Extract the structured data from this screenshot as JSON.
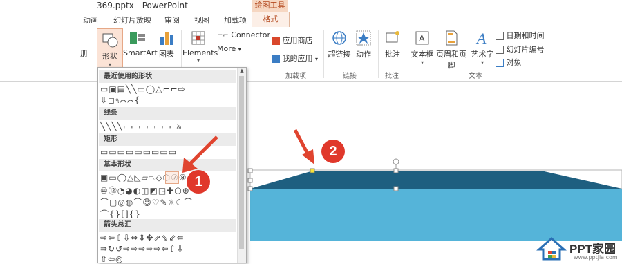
{
  "window": {
    "title": "369.pptx - PowerPoint",
    "contextual_group": "绘图工具"
  },
  "tabs": [
    "动画",
    "幻灯片放映",
    "审阅",
    "视图",
    "加载项",
    "格式"
  ],
  "ribbon": {
    "partial_left_label": "册",
    "shapes_label": "形状",
    "smartart_label": "SmartArt",
    "chart_label": "图表",
    "elements_label": "Elements",
    "connector_label": "Connector",
    "more_label": "More",
    "app_store_label": "应用商店",
    "my_apps_label": "我的应用",
    "addins_group": "加载项",
    "hyperlink_label": "超链接",
    "action_label": "动作",
    "links_group": "链接",
    "comment_label": "批注",
    "comments_group": "批注",
    "textbox_label": "文本框",
    "header_footer_label": "页眉和页脚",
    "wordart_label": "艺术字",
    "datetime_label": "日期和时间",
    "slide_number_label": "幻灯片编号",
    "object_label": "对象",
    "text_group": "文本"
  },
  "gallery": {
    "recent": "最近使用的形状",
    "lines": "线条",
    "rectangles": "矩形",
    "basic": "基本形状",
    "arrows": "箭头总汇",
    "rows": {
      "recent1": "▭▣▤╲╲▭◯△⌐⌐⇨",
      "recent2": "⇩◻ঀ⌒⌒{",
      "lines1": "╲╲╲╲⌐⌐⌐⌐⌐⌐⌐ঌ",
      "rect1": "▭▭▭▭▭▭▭▭▭",
      "basic1": "▣▭◯△◺▱⏢◇⬡⑦⑧",
      "basic2": "⑩⑫◔◕◐◫◩◳✚⬡⊕",
      "basic3": "⌒▢◎◍⌒☺♡✎☼☾⌒",
      "basic4": "⌒{}[]{}",
      "arrows1": "⇨⇦⇧⇩⇔⇕✥⇗⇘⇙⇚",
      "arrows2": "⇛↻↺⇨⇨⇨⇨⇨⇦⇧⇩",
      "arrows3": "⇧⇦◎"
    }
  },
  "annotations": {
    "step1": "1",
    "step2": "2"
  },
  "logo": {
    "text": "PPT家园",
    "subtext": "www.pptjia.com"
  },
  "colors": {
    "shape_top": "#1e5f80",
    "shape_body": "#55b4d9",
    "badge": "#e0382b",
    "arrow": "#e0442f",
    "accent": "#b3491f"
  }
}
